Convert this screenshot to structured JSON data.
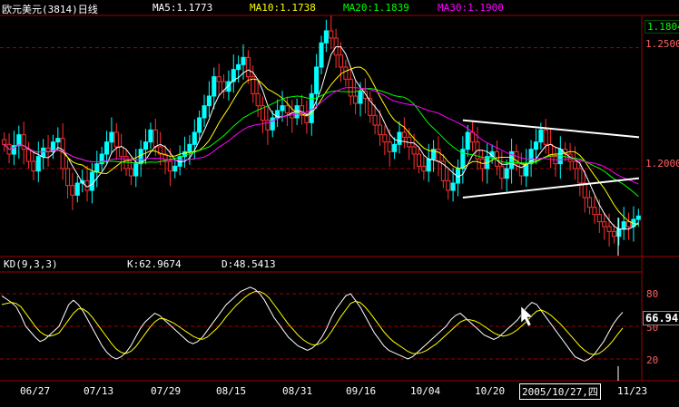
{
  "colors": {
    "up": "#00ffff",
    "down": "#ff3030",
    "ma5": "#ffffff",
    "ma10": "#ffff00",
    "ma20": "#00ff00",
    "ma30": "#ff00ff",
    "k_line": "#ffffff",
    "d_line": "#ffff00",
    "grid": "#a00000",
    "axis_text": "#ff6060",
    "trendline": "#ffffff"
  },
  "header": {
    "title": "欧元美元(3814)日线",
    "ma5": "MA5:1.1773",
    "ma10": "MA10:1.1738",
    "ma20": "MA20:1.1839",
    "ma30": "MA30:1.1900"
  },
  "price_axis": {
    "last_price": "1.1804",
    "ticks": [
      "1.2500",
      "1.2000"
    ]
  },
  "indicator_header": {
    "name": "KD(9,3,3)",
    "k": "K:62.9674",
    "d": "D:48.5413"
  },
  "kd_axis": {
    "ticks": [
      "80",
      "50",
      "20"
    ],
    "current_value": "66.94"
  },
  "cursor_date": "2005/10/27,四",
  "chart_data": [
    {
      "type": "candlestick",
      "title": "欧元美元(3814)日线",
      "x_ticks": [
        "06/27",
        "07/13",
        "07/29",
        "08/15",
        "08/31",
        "09/16",
        "10/04",
        "10/20",
        "11/23"
      ],
      "ylim": [
        1.164,
        1.263
      ],
      "y_ticks": [
        1.25,
        1.2
      ],
      "grid": true,
      "moving_averages": [
        "MA5",
        "MA10",
        "MA20",
        "MA30"
      ],
      "close": [
        1.21,
        1.206,
        1.2095,
        1.214,
        1.208,
        1.203,
        1.199,
        1.205,
        1.2085,
        1.207,
        1.211,
        1.2125,
        1.2,
        1.193,
        1.189,
        1.194,
        1.195,
        1.191,
        1.1985,
        1.202,
        1.206,
        1.211,
        1.215,
        1.209,
        1.205,
        1.2,
        1.197,
        1.202,
        1.208,
        1.211,
        1.216,
        1.209,
        1.206,
        1.203,
        1.199,
        1.201,
        1.205,
        1.207,
        1.21,
        1.215,
        1.221,
        1.226,
        1.23,
        1.238,
        1.236,
        1.232,
        1.236,
        1.241,
        1.243,
        1.246,
        1.238,
        1.231,
        1.226,
        1.22,
        1.216,
        1.221,
        1.224,
        1.226,
        1.223,
        1.221,
        1.226,
        1.222,
        1.219,
        1.231,
        1.242,
        1.252,
        1.257,
        1.254,
        1.247,
        1.242,
        1.237,
        1.23,
        1.227,
        1.232,
        1.229,
        1.222,
        1.218,
        1.214,
        1.211,
        1.207,
        1.21,
        1.215,
        1.213,
        1.209,
        1.206,
        1.201,
        1.199,
        1.204,
        1.208,
        1.203,
        1.195,
        1.191,
        1.194,
        1.2,
        1.208,
        1.215,
        1.211,
        1.204,
        1.2,
        1.205,
        1.207,
        1.201,
        1.196,
        1.2,
        1.207,
        1.202,
        1.197,
        1.202,
        1.208,
        1.211,
        1.216,
        1.21,
        1.205,
        1.202,
        1.208,
        1.206,
        1.203,
        1.2,
        1.194,
        1.188,
        1.184,
        1.181,
        1.178,
        1.176,
        1.174,
        1.172,
        1.175,
        1.178,
        1.176,
        1.179,
        1.1804
      ]
    },
    {
      "type": "line",
      "title": "KD(9,3,3)",
      "ylim": [
        0,
        100
      ],
      "y_ticks": [
        80,
        50,
        20
      ],
      "grid": true,
      "series": [
        {
          "name": "K",
          "values": [
            78,
            75,
            72,
            68,
            60,
            50,
            45,
            40,
            36,
            38,
            42,
            46,
            50,
            60,
            70,
            74,
            70,
            64,
            56,
            48,
            40,
            32,
            26,
            22,
            20,
            22,
            26,
            32,
            40,
            48,
            54,
            58,
            62,
            60,
            56,
            52,
            48,
            44,
            40,
            36,
            34,
            36,
            40,
            46,
            52,
            58,
            64,
            70,
            74,
            78,
            82,
            84,
            86,
            84,
            80,
            74,
            66,
            58,
            52,
            46,
            40,
            36,
            32,
            30,
            28,
            30,
            34,
            40,
            48,
            58,
            66,
            72,
            78,
            80,
            74,
            68,
            60,
            52,
            44,
            38,
            32,
            28,
            26,
            24,
            22,
            20,
            22,
            26,
            30,
            34,
            38,
            42,
            46,
            50,
            56,
            60,
            62,
            58,
            54,
            50,
            46,
            42,
            40,
            38,
            40,
            44,
            48,
            52,
            56,
            62,
            68,
            72,
            70,
            64,
            58,
            52,
            46,
            40,
            34,
            28,
            22,
            20,
            18,
            20,
            24,
            30,
            36,
            44,
            52,
            58,
            62.9674
          ]
        },
        {
          "name": "D",
          "values": [
            70,
            71,
            72,
            71,
            68,
            62,
            56,
            50,
            45,
            42,
            41,
            42,
            44,
            50,
            56,
            62,
            66,
            66,
            63,
            58,
            52,
            46,
            40,
            34,
            29,
            26,
            25,
            27,
            31,
            37,
            43,
            49,
            54,
            57,
            57,
            55,
            53,
            50,
            47,
            44,
            41,
            39,
            38,
            40,
            44,
            48,
            53,
            59,
            64,
            69,
            73,
            77,
            80,
            82,
            82,
            80,
            76,
            70,
            64,
            58,
            52,
            47,
            42,
            38,
            35,
            33,
            33,
            35,
            39,
            45,
            52,
            59,
            65,
            71,
            73,
            72,
            68,
            63,
            57,
            51,
            45,
            40,
            36,
            33,
            30,
            27,
            25,
            25,
            26,
            28,
            31,
            34,
            38,
            42,
            46,
            50,
            54,
            56,
            56,
            55,
            53,
            50,
            47,
            44,
            42,
            41,
            42,
            44,
            47,
            51,
            55,
            60,
            64,
            65,
            63,
            60,
            56,
            52,
            47,
            42,
            37,
            32,
            28,
            25,
            24,
            25,
            28,
            32,
            37,
            43,
            48.5413
          ]
        }
      ]
    }
  ]
}
